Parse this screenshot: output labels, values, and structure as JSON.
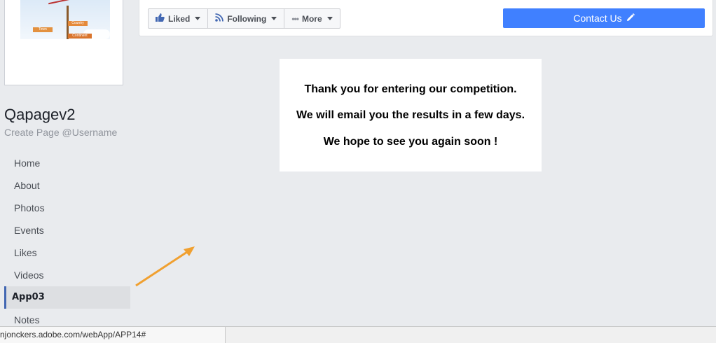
{
  "page": {
    "name": "Qapagev2",
    "username_link": "Create Page @Username"
  },
  "profile_image": {
    "signs": [
      "Country",
      "Town",
      "Continent"
    ]
  },
  "nav": {
    "items": [
      {
        "label": "Home",
        "active": false
      },
      {
        "label": "About",
        "active": false
      },
      {
        "label": "Photos",
        "active": false
      },
      {
        "label": "Events",
        "active": false
      },
      {
        "label": "Likes",
        "active": false
      },
      {
        "label": "Videos",
        "active": false
      },
      {
        "label": "App03",
        "active": true
      },
      {
        "label": "Notes",
        "active": false
      }
    ]
  },
  "actions": {
    "liked": {
      "label": "Liked",
      "icon": "thumbs-up-icon"
    },
    "following": {
      "label": "Following",
      "icon": "rss-icon"
    },
    "more": {
      "label": "More",
      "icon": "dots-icon"
    },
    "contact": {
      "label": "Contact Us",
      "icon": "pencil-icon"
    }
  },
  "message": {
    "line1": "Thank you for entering our competition.",
    "line2": "We will email you the results in a few days.",
    "line3": "We hope to see you again soon !"
  },
  "status_bar": {
    "url": "njonckers.adobe.com/webApp/APP14#"
  },
  "colors": {
    "accent": "#4080ff",
    "nav_active_border": "#4267b2",
    "annotation_arrow": "#f0a030"
  }
}
